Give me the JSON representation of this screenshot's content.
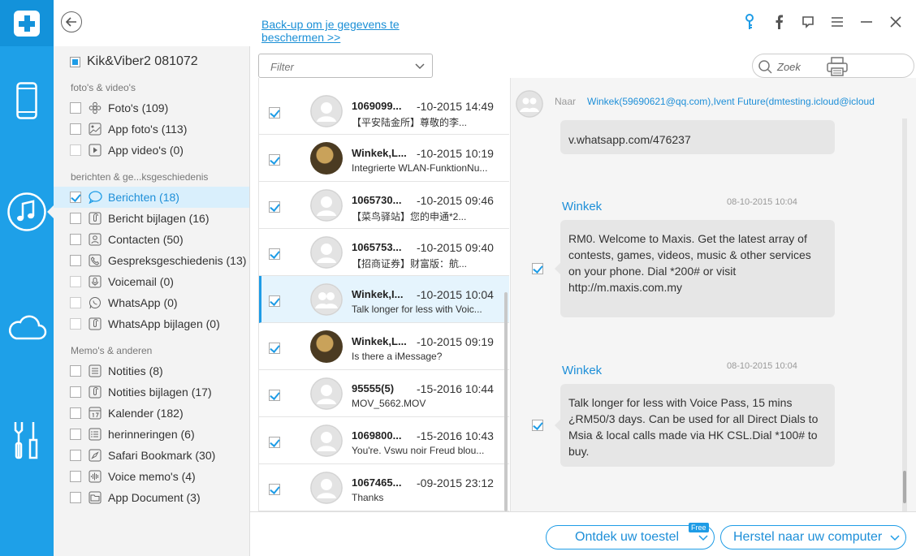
{
  "header": {
    "backup_link": "Back-up om je gegevens te beschermen >>"
  },
  "device": {
    "name": "Kik&Viber2 081072"
  },
  "sections": {
    "media": "foto's & video's",
    "messages": "berichten & ge...ksgeschiedenis",
    "memos": "Memo's & anderen"
  },
  "categories": [
    {
      "label": "Foto's (109)",
      "icon": "flower-icon"
    },
    {
      "label": "App foto's (113)",
      "icon": "image-icon"
    },
    {
      "label": "App video's (0)",
      "icon": "play-icon"
    },
    {
      "label": "Berichten (18)",
      "icon": "chat-bubble-icon"
    },
    {
      "label": "Bericht bijlagen (16)",
      "icon": "paperclip-icon"
    },
    {
      "label": "Contacten (50)",
      "icon": "contacts-icon"
    },
    {
      "label": "Gespreksgeschiedenis (13)",
      "icon": "phone-icon"
    },
    {
      "label": "Voicemail (0)",
      "icon": "mic-icon"
    },
    {
      "label": "WhatsApp (0)",
      "icon": "whatsapp-icon"
    },
    {
      "label": "WhatsApp bijlagen (0)",
      "icon": "paperclip-icon"
    },
    {
      "label": "Notities (8)",
      "icon": "notes-icon"
    },
    {
      "label": "Notities bijlagen (17)",
      "icon": "paperclip-icon"
    },
    {
      "label": "Kalender (182)",
      "icon": "calendar-icon"
    },
    {
      "label": "herinneringen (6)",
      "icon": "list-icon"
    },
    {
      "label": "Safari Bookmark (30)",
      "icon": "compass-icon"
    },
    {
      "label": "Voice memo's (4)",
      "icon": "waveform-icon"
    },
    {
      "label": "App Document (3)",
      "icon": "folder-icon"
    }
  ],
  "list": {
    "filter_placeholder": "Filter",
    "rows": [
      {
        "sender": "1069099...",
        "date": "-10-2015 14:49",
        "preview": "【平安陆金所】尊敬的李..."
      },
      {
        "sender": "Winkek,L...",
        "date": "-10-2015 10:19",
        "preview": "Integrierte WLAN-FunktionNu..."
      },
      {
        "sender": "1065730...",
        "date": "-10-2015 09:46",
        "preview": "【菜鸟驿站】您的申通*2..."
      },
      {
        "sender": "1065753...",
        "date": "-10-2015 09:40",
        "preview": "【招商证券】财富版：航..."
      },
      {
        "sender": "Winkek,I...",
        "date": "-10-2015 10:04",
        "preview": "Talk longer for less with Voic..."
      },
      {
        "sender": "Winkek,L...",
        "date": "-10-2015 09:19",
        "preview": "Is there a iMessage?"
      },
      {
        "sender": "95555(5)",
        "date": "-15-2016 10:44",
        "preview": "MOV_5662.MOV"
      },
      {
        "sender": "1069800...",
        "date": "-15-2016 10:43",
        "preview": "You're. Vswu noir Freud blou..."
      },
      {
        "sender": "1067465...",
        "date": "-09-2015 23:12",
        "preview": "Thanks"
      }
    ]
  },
  "detail": {
    "search_placeholder": "Zoek",
    "to_label": "Naar",
    "to_value": "Winkek(59690621@qq.com),Ivent  Future(dmtesting.icloud@icloud",
    "top_bubble": "v.whatsapp.com/476237",
    "messages": [
      {
        "sender": "Winkek",
        "time": "08-10-2015 10:04",
        "text": "RM0. Welcome to Maxis. Get the latest array of contests,  games, videos, music & other services on your phone. Dial *200# or visit http://m.maxis.com.my"
      },
      {
        "sender": "Winkek",
        "time": "08-10-2015 10:04",
        "text": "Talk longer for less with Voice Pass, 15 mins ¿RM50/3 days. Can be used for all Direct Dials to Msia & local calls made via HK CSL.Dial *100# to buy."
      }
    ]
  },
  "footer": {
    "discover": "Ontdek uw toestel",
    "free_badge": "Free",
    "restore": "Herstel naar uw computer"
  },
  "colors": {
    "accent": "#1ea0e8",
    "rail_dark": "#1392da"
  }
}
